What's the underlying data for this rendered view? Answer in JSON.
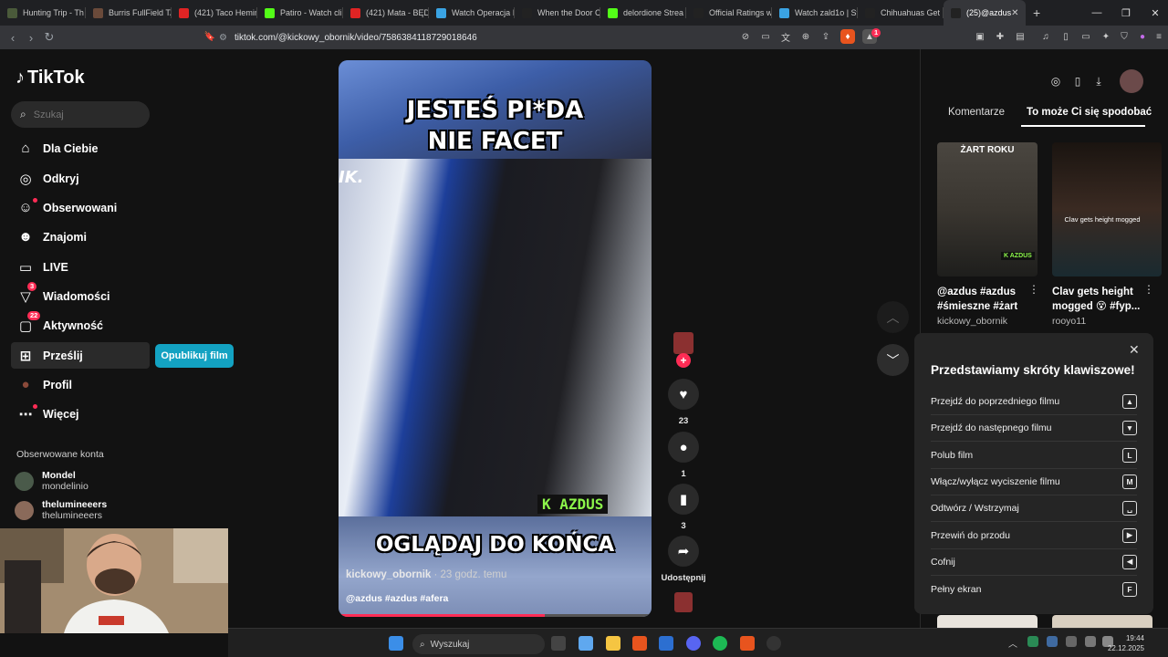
{
  "browser": {
    "tabs": [
      {
        "label": "Hunting Trip - Th",
        "icon_color": "#4a5a3a"
      },
      {
        "label": "Burris FullField TA",
        "icon_color": "#6a4a3a"
      },
      {
        "label": "(421) Taco Hemin",
        "icon_color": "#e02424"
      },
      {
        "label": "Patiro - Watch cli",
        "icon_color": "#53fc18"
      },
      {
        "label": "(421) Mata - BĘD",
        "icon_color": "#e02424"
      },
      {
        "label": "Watch Operacja I",
        "icon_color": "#3aa3e3"
      },
      {
        "label": "When the Door C",
        "icon_color": "#222222"
      },
      {
        "label": "delordione Strea",
        "icon_color": "#53fc18"
      },
      {
        "label": "Official Ratings w",
        "icon_color": "#222222"
      },
      {
        "label": "Watch zald1o | St",
        "icon_color": "#3aa3e3"
      },
      {
        "label": "Chihuahuas Get I",
        "icon_color": "#222222"
      },
      {
        "label": "(25)@azdus",
        "icon_color": "#222222"
      }
    ],
    "new_tab": "+",
    "url": "tiktok.com/@kickowy_obornik/video/7586384118729018646",
    "ext_badge": "1"
  },
  "sidebar": {
    "logo": "TikTok",
    "search_placeholder": "Szukaj",
    "nav": [
      {
        "label": "Dla Ciebie",
        "icon": "home-icon",
        "glyph": "⌂"
      },
      {
        "label": "Odkryj",
        "icon": "compass-icon",
        "glyph": "◎"
      },
      {
        "label": "Obserwowani",
        "icon": "following-icon",
        "glyph": "☺"
      },
      {
        "label": "Znajomi",
        "icon": "friends-icon",
        "glyph": "☻"
      },
      {
        "label": "LIVE",
        "icon": "live-icon",
        "glyph": "▭"
      },
      {
        "label": "Wiadomości",
        "icon": "messages-icon",
        "glyph": "▽",
        "badge": "3"
      },
      {
        "label": "Aktywność",
        "icon": "activity-icon",
        "glyph": "▢",
        "badge": "22"
      },
      {
        "label": "Prześlij",
        "icon": "upload-icon",
        "glyph": "⊞"
      },
      {
        "label": "Profil",
        "icon": "profile-avatar-icon",
        "glyph": "●"
      },
      {
        "label": "Więcej",
        "icon": "more-icon",
        "glyph": "⋯"
      }
    ],
    "publish_button": "Opublikuj film",
    "followed_title": "Obserwowane konta",
    "accounts": [
      {
        "name": "Mondel",
        "handle": "mondelinio"
      },
      {
        "name": "thelumineeers",
        "handle": "thelumineeers"
      }
    ]
  },
  "video": {
    "caption_top_1": "JESTEŚ PI*DA",
    "caption_top_2": "NIE FACET",
    "watermark_left": "IK.",
    "watermark_right": "K AZDUS",
    "caption_bottom": "OGLĄDAJ DO KOŃCA",
    "author": "kickowy_obornik",
    "time": " · 23 godz. temu",
    "tags": "@azdus #azdus #afera",
    "progress_fraction": 0.66
  },
  "actions": {
    "likes": "23",
    "comments": "1",
    "saves": "3",
    "share_label": "Udostępnij"
  },
  "right_panel": {
    "tabs": [
      "Komentarze",
      "To może Ci się spodobać"
    ],
    "videos": [
      {
        "title": "@azdus #azdus #śmieszne #żart",
        "author": "kickowy_obornik",
        "thumb_top_text": "ŻART ROKU",
        "thumb_bottom_text": "K AZDUS"
      },
      {
        "title": "Clav gets height mogged 😵 #fyp...",
        "author": "rooyo11",
        "thumb_top_text": "Clav gets height mogged",
        "thumb_bottom_text": ""
      }
    ]
  },
  "shortcuts": {
    "title": "Przedstawiamy skróty klawiszowe!",
    "rows": [
      {
        "label": "Przejdź do poprzedniego filmu",
        "key": "▲"
      },
      {
        "label": "Przejdź do następnego filmu",
        "key": "▼"
      },
      {
        "label": "Polub film",
        "key": "L"
      },
      {
        "label": "Włącz/wyłącz wyciszenie filmu",
        "key": "M"
      },
      {
        "label": "Odtwórz / Wstrzymaj",
        "key": "␣"
      },
      {
        "label": "Przewiń do przodu",
        "key": "▶"
      },
      {
        "label": "Cofnij",
        "key": "◀"
      },
      {
        "label": "Pełny ekran",
        "key": "F"
      }
    ]
  },
  "taskbar": {
    "search_placeholder": "Wyszukaj",
    "time": "19:44",
    "date": "22.12.2025"
  },
  "colors": {
    "accent": "#fe2c55",
    "publish": "#13a2c2",
    "azdus_green": "#8cf54a"
  }
}
